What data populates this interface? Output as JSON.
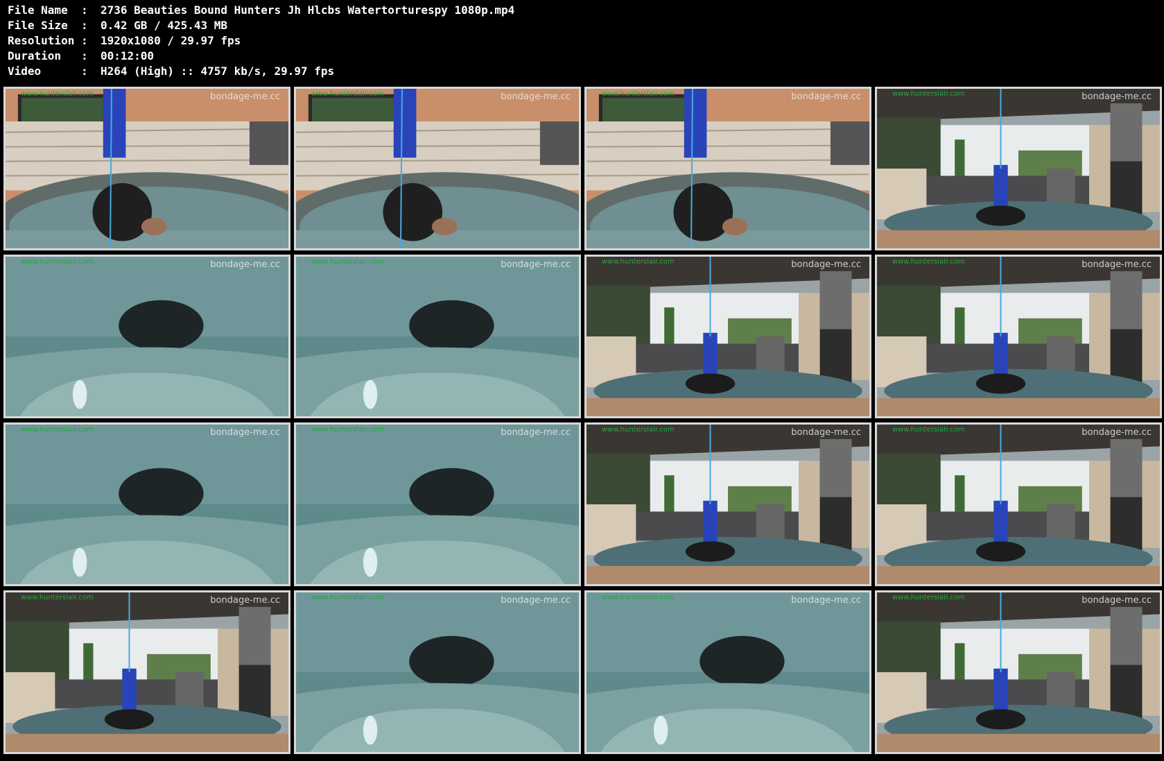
{
  "header": {
    "rows": [
      {
        "label": "File Name",
        "sep": ":",
        "value": "2736 Beauties Bound Hunters Jh Hlcbs Watertorturespy 1080p.mp4"
      },
      {
        "label": "File Size",
        "sep": ":",
        "value": "0.42 GB  / 425.43 MB"
      },
      {
        "label": "Resolution",
        "sep": ":",
        "value": "1920x1080 / 29.97 fps"
      },
      {
        "label": "Duration",
        "sep": ":",
        "value": "00:12:00"
      },
      {
        "label": "Video",
        "sep": ":",
        "value": "H264 (High) :: 4757 kb/s, 29.97 fps"
      }
    ]
  },
  "watermarks": {
    "left": "www.hunterslair.com",
    "right": "bondage-me.cc"
  },
  "colors": {
    "background": "#000000",
    "text": "#ffffff",
    "thumb_border": "#d8d8d8",
    "watermark_green": "#22a83a"
  },
  "thumbnails": [
    {
      "scene": "poolside-closeup"
    },
    {
      "scene": "poolside-closeup"
    },
    {
      "scene": "poolside-closeup"
    },
    {
      "scene": "patio-wide"
    },
    {
      "scene": "underwater"
    },
    {
      "scene": "underwater"
    },
    {
      "scene": "patio-wide"
    },
    {
      "scene": "patio-wide"
    },
    {
      "scene": "underwater"
    },
    {
      "scene": "underwater"
    },
    {
      "scene": "patio-wide"
    },
    {
      "scene": "patio-wide"
    },
    {
      "scene": "patio-wide"
    },
    {
      "scene": "underwater"
    },
    {
      "scene": "underwater"
    },
    {
      "scene": "patio-wide"
    }
  ]
}
